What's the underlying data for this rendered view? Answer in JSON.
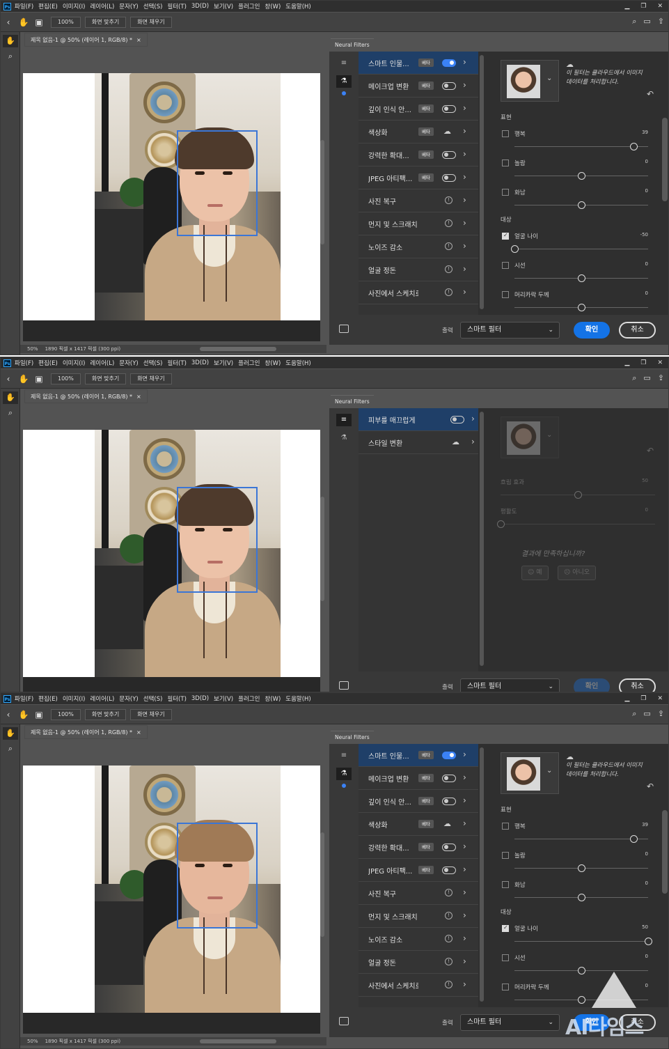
{
  "menu": [
    "파일(F)",
    "편집(E)",
    "이미지(I)",
    "레이어(L)",
    "문자(Y)",
    "선택(S)",
    "필터(T)",
    "3D(D)",
    "보기(V)",
    "플러그인",
    "창(W)",
    "도움말(H)"
  ],
  "options": {
    "zoom": "100%",
    "fit": "화면 맞추기",
    "fill": "화면 채우기"
  },
  "doc": {
    "tab": "제목 없음-1 @ 50% (레이어 1, RGB/8) *",
    "close": "×",
    "zoom": "50%",
    "info": "1890 픽셀 x 1417 픽셀 (300 ppi)"
  },
  "nf": {
    "title": "Neural Filters",
    "filters": [
      {
        "label": "스마트 인물...",
        "badge": "베타",
        "control": "toggle-on"
      },
      {
        "label": "메이크업 변환",
        "badge": "베타",
        "control": "toggle"
      },
      {
        "label": "깊이 인식 안...",
        "badge": "베타",
        "control": "toggle"
      },
      {
        "label": "색상화",
        "badge": "베타",
        "control": "cloud"
      },
      {
        "label": "강력한 확대...",
        "badge": "베타",
        "control": "toggle"
      },
      {
        "label": "JPEG 아티팩...",
        "badge": "베타",
        "control": "toggle"
      },
      {
        "label": "사진 복구",
        "badge": "",
        "control": "info"
      },
      {
        "label": "먼지 및 스크래치",
        "badge": "",
        "control": "info"
      },
      {
        "label": "노이즈 감소",
        "badge": "",
        "control": "info"
      },
      {
        "label": "얼굴 정돈",
        "badge": "",
        "control": "info"
      },
      {
        "label": "사진에서 스케치로",
        "badge": "",
        "control": "info"
      }
    ],
    "featured": [
      {
        "label": "피부를 매끄럽게",
        "control": "toggle"
      },
      {
        "label": "스타일 변환",
        "control": "cloud"
      }
    ],
    "cloud_note": "이 필터는 클라우드에서 이미지 데이터를 처리합니다.",
    "expression_header": "표현",
    "target_header": "대상",
    "sliders": [
      {
        "label": "행복",
        "value": "39"
      },
      {
        "label": "놀람",
        "value": "0"
      },
      {
        "label": "화남",
        "value": "0"
      }
    ],
    "target_sliders_a": [
      {
        "label": "얼굴 나이",
        "value": "-50",
        "checked": true
      },
      {
        "label": "시선",
        "value": "0",
        "checked": false
      },
      {
        "label": "머리카락 두께",
        "value": "0",
        "checked": false
      }
    ],
    "target_sliders_c": [
      {
        "label": "얼굴 나이",
        "value": "50",
        "checked": true
      },
      {
        "label": "시선",
        "value": "0",
        "checked": false
      },
      {
        "label": "머리카락 두께",
        "value": "0",
        "checked": false
      }
    ],
    "skin_sliders": [
      {
        "label": "흐림 효과",
        "value": "50"
      },
      {
        "label": "평활도",
        "value": "0"
      }
    ],
    "satisfaction": "결과에 만족하십니까?",
    "yes": "예",
    "no": "아니오",
    "output_label": "출력",
    "output_value": "스마트 필터",
    "ok": "확인",
    "cancel": "취소"
  },
  "watermark": "AI타임스"
}
